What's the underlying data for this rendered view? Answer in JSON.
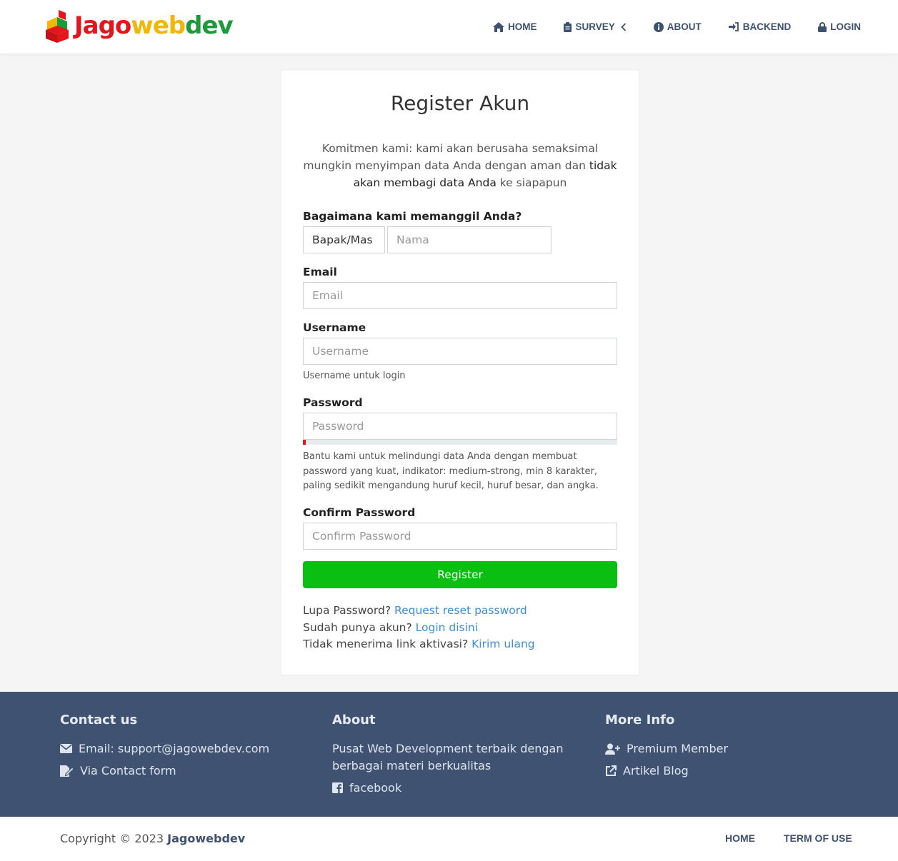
{
  "brand": {
    "part1": "Jago",
    "part2": "web",
    "part3": "dev",
    "colors": [
      "#e3171b",
      "#f2b705",
      "#1a9c3b"
    ]
  },
  "nav": [
    {
      "label": "HOME",
      "icon": "home-icon"
    },
    {
      "label": "SURVEY",
      "icon": "clipboard-icon"
    },
    {
      "label": "ABOUT",
      "icon": "info-icon"
    },
    {
      "label": "BACKEND",
      "icon": "sign-in-icon"
    },
    {
      "label": "LOGIN",
      "icon": "lock-icon"
    }
  ],
  "form": {
    "title": "Register Akun",
    "intro_before": "Komitmen kami: kami akan berusaha semaksimal mungkin menyimpan data Anda dengan aman dan ",
    "intro_bold": "tidak akan membagi data Anda",
    "intro_after": " ke siapapun",
    "call_label": "Bagaimana kami memanggil Anda?",
    "salutation_value": "Bapak/Mas",
    "name_placeholder": "Nama",
    "email_label": "Email",
    "email_placeholder": "Email",
    "username_label": "Username",
    "username_placeholder": "Username",
    "username_hint": "Username untuk login",
    "password_label": "Password",
    "password_placeholder": "Password",
    "password_strength": 0.01,
    "password_hint": "Bantu kami untuk melindungi data Anda dengan membuat password yang kuat, indikator: medium-strong, min 8 karakter, paling sedikit mengandung huruf kecil, huruf besar, dan angka.",
    "confirm_label": "Confirm Password",
    "confirm_placeholder": "Confirm Password",
    "submit_label": "Register",
    "links": [
      {
        "text": "Lupa Password? ",
        "link": "Request reset password"
      },
      {
        "text": "Sudah punya akun? ",
        "link": "Login disini"
      },
      {
        "text": "Tidak menerima link aktivasi? ",
        "link": "Kirim ulang"
      }
    ]
  },
  "footer": {
    "contact_title": "Contact us",
    "contact_email": "Email: support@jagowebdev.com",
    "contact_form": "Via Contact form",
    "about_title": "About",
    "about_text": "Pusat Web Development terbaik dengan berbagai materi berkualitas",
    "about_facebook": "facebook",
    "more_title": "More Info",
    "more_premium": "Premium Member",
    "more_blog": "Artikel Blog"
  },
  "bottom": {
    "copyright": "Copyright © 2023 ",
    "brand": "Jagowebdev",
    "home": "HOME",
    "terms": "TERM OF USE"
  }
}
